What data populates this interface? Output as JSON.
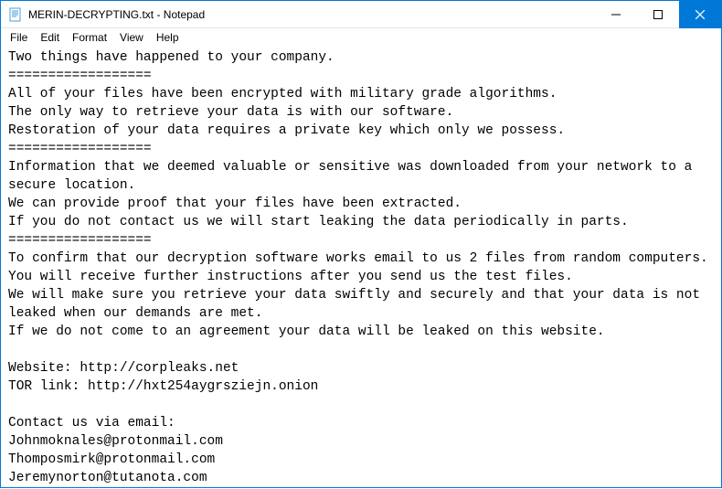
{
  "window": {
    "title": "MERIN-DECRYPTING.txt - Notepad"
  },
  "menu": {
    "file": "File",
    "edit": "Edit",
    "format": "Format",
    "view": "View",
    "help": "Help"
  },
  "document": {
    "text": "Two things have happened to your company.\n==================\nAll of your files have been encrypted with military grade algorithms.\nThe only way to retrieve your data is with our software.\nRestoration of your data requires a private key which only we possess.\n==================\nInformation that we deemed valuable or sensitive was downloaded from your network to a secure location.\nWe can provide proof that your files have been extracted.\nIf you do not contact us we will start leaking the data periodically in parts.\n==================\nTo confirm that our decryption software works email to us 2 files from random computers.\nYou will receive further instructions after you send us the test files.\nWe will make sure you retrieve your data swiftly and securely and that your data is not leaked when our demands are met.\nIf we do not come to an agreement your data will be leaked on this website.\n\nWebsite: http://corpleaks.net\nTOR link: http://hxt254aygrsziejn.onion\n\nContact us via email:\nJohnmoknales@protonmail.com\nThomposmirk@protonmail.com\nJeremynorton@tutanota.com"
  }
}
